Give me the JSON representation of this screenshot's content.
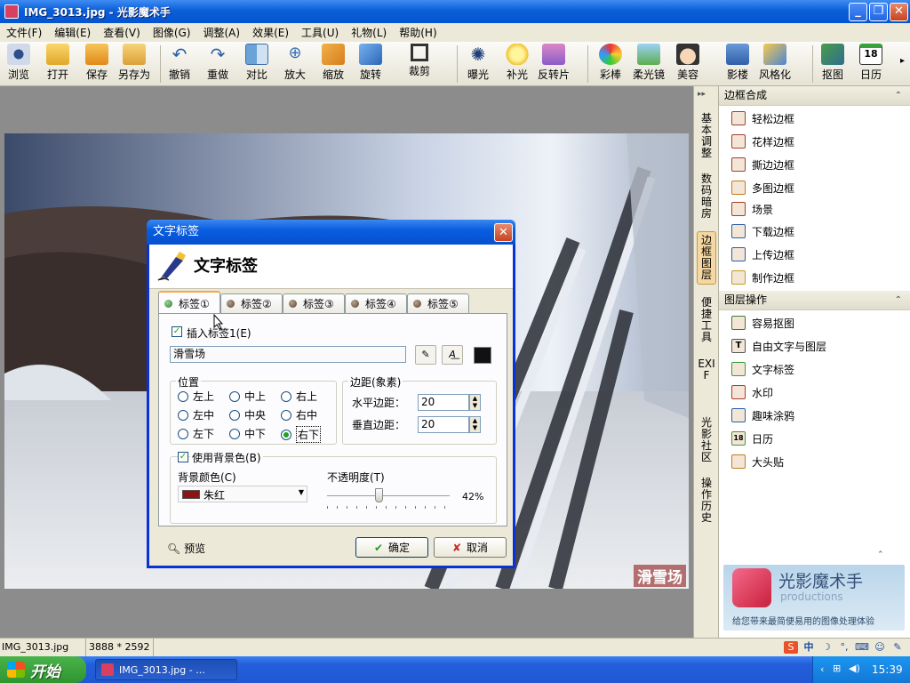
{
  "window": {
    "title": "IMG_3013.jpg - 光影魔术手"
  },
  "menu": [
    "文件(F)",
    "编辑(E)",
    "查看(V)",
    "图像(G)",
    "调整(A)",
    "效果(E)",
    "工具(U)",
    "礼物(L)",
    "帮助(H)"
  ],
  "toolbar": {
    "browse": "浏览",
    "open": "打开",
    "save": "保存",
    "saveas": "另存为",
    "undo": "撤销",
    "redo": "重做",
    "compare": "对比",
    "zoomin": "放大",
    "resize": "缩放",
    "rotate": "旋转",
    "crop": "裁剪",
    "exposure": "曝光",
    "fill": "补光",
    "reverse": "反转片",
    "color": "彩棒",
    "soft": "柔光镜",
    "beauty": "美容",
    "shadow": "影楼",
    "style": "风格化",
    "cutout": "抠图",
    "calendar": "日历"
  },
  "vtabs": [
    "基本调整",
    "数码暗房",
    "边框图层",
    "便捷工具",
    "EXIF",
    "光影社区",
    "操作历史"
  ],
  "panel": {
    "border_header": "边框合成",
    "border_items": [
      "轻松边框",
      "花样边框",
      "撕边边框",
      "多图边框",
      "场景",
      "下载边框",
      "上传边框",
      "制作边框"
    ],
    "layer_header": "图层操作",
    "layer_items": [
      "容易抠图",
      "自由文字与图层",
      "文字标签",
      "水印",
      "趣味涂鸦",
      "日历",
      "大头贴"
    ]
  },
  "ad": {
    "name": "光影魔术手",
    "sub": "productions",
    "slogan": "给您带来最简便易用的图像处理体验"
  },
  "photo_label": "滑雪场",
  "status": {
    "file": "IMG_3013.jpg",
    "dims": "3888 * 2592"
  },
  "taskbar": {
    "start": "开始",
    "item": "IMG_3013.jpg - ...",
    "clock": "15:39"
  },
  "dialog": {
    "title": "文字标签",
    "heading": "文字标签",
    "tabs": [
      "标签①",
      "标签②",
      "标签③",
      "标签④",
      "标签⑤"
    ],
    "insert_label": "插入标签1(E)",
    "text_value": "滑雪场",
    "position_title": "位置",
    "positions": [
      "左上",
      "中上",
      "右上",
      "左中",
      "中央",
      "右中",
      "左下",
      "中下",
      "右下"
    ],
    "selected_position": "右下",
    "margin_title": "边距(象素)",
    "h_margin_label": "水平边距：",
    "h_margin": "20",
    "v_margin_label": "垂直边距：",
    "v_margin": "20",
    "use_bg": "使用背景色(B)",
    "bg_color_label": "背景颜色(C)",
    "bg_color_name": "朱红",
    "bg_color": "#8b1414",
    "opacity_label": "不透明度(T)",
    "opacity": "42%",
    "opacity_fraction": 0.42,
    "preview": "预览",
    "ok": "确定",
    "cancel": "取消"
  }
}
